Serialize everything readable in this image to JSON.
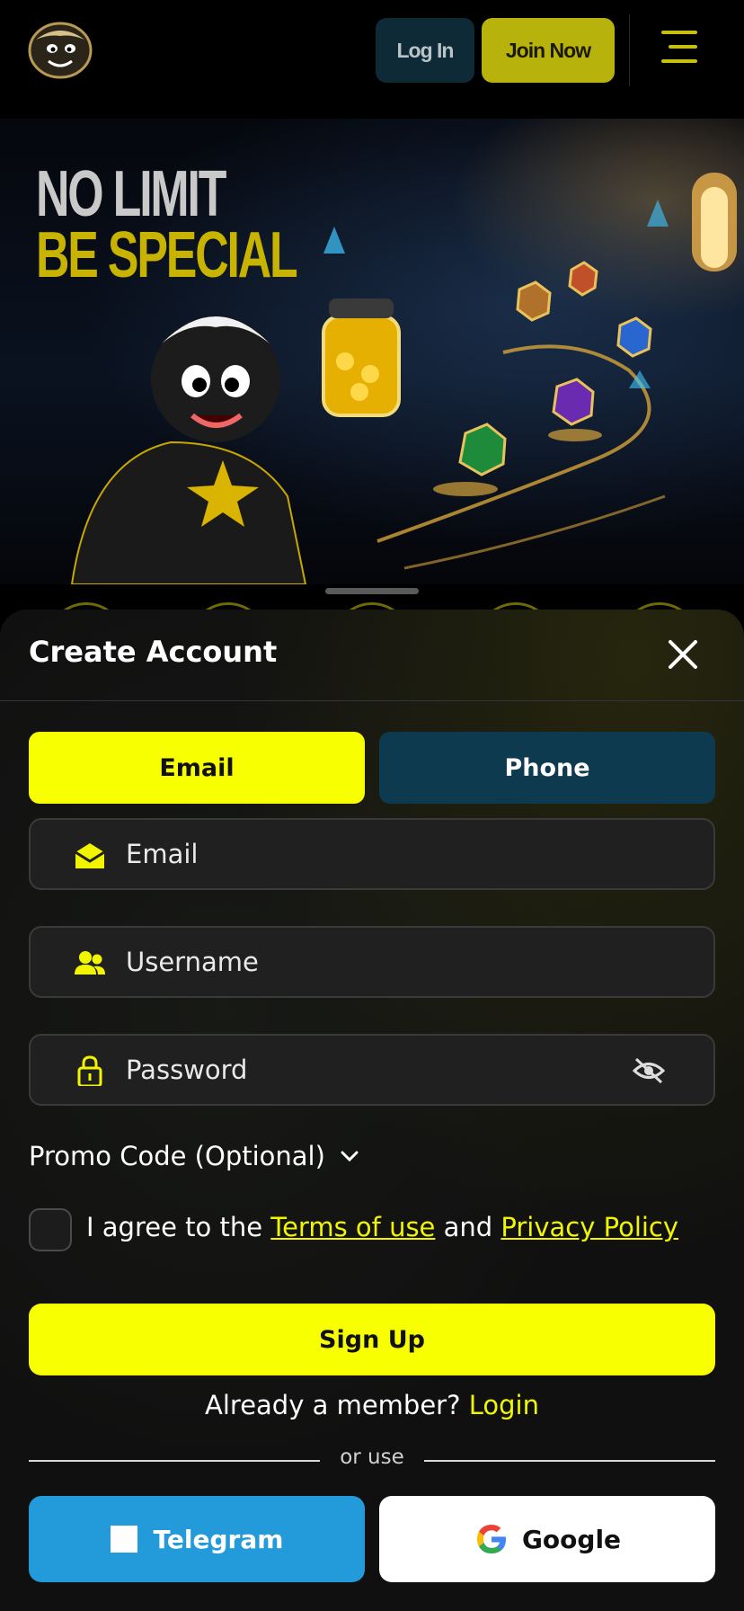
{
  "header": {
    "login_label": "Log In",
    "join_label": "Join Now"
  },
  "hero": {
    "line1": "NO LIMIT",
    "line2": "BE SPECIAL"
  },
  "signup_sheet": {
    "title": "Create Account",
    "tabs": [
      {
        "label": "Email",
        "active": true
      },
      {
        "label": "Phone",
        "active": false
      }
    ],
    "fields": {
      "email": {
        "placeholder": "Email",
        "value": "",
        "icon": "envelope-icon"
      },
      "username": {
        "placeholder": "Username",
        "value": "",
        "icon": "users-icon"
      },
      "password": {
        "placeholder": "Password",
        "value": "",
        "icon": "lock-icon",
        "toggle_icon": "eye-off-icon"
      }
    },
    "promo_label": "Promo Code (Optional)",
    "agree": {
      "prefix": "I agree to the",
      "terms": "Terms of use",
      "and": "and",
      "privacy": "Privacy Policy",
      "checked": false
    },
    "signup_label": "Sign Up",
    "member_text": "Already a member?",
    "login_link": "Login",
    "or_use": "or use",
    "social": {
      "telegram": "Telegram",
      "google": "Google"
    }
  },
  "colors": {
    "accent_yellow": "#f8ff00",
    "brand_olive": "#b8b20c",
    "tab_inactive": "#0d3a4e",
    "telegram_blue": "#239ad9"
  }
}
